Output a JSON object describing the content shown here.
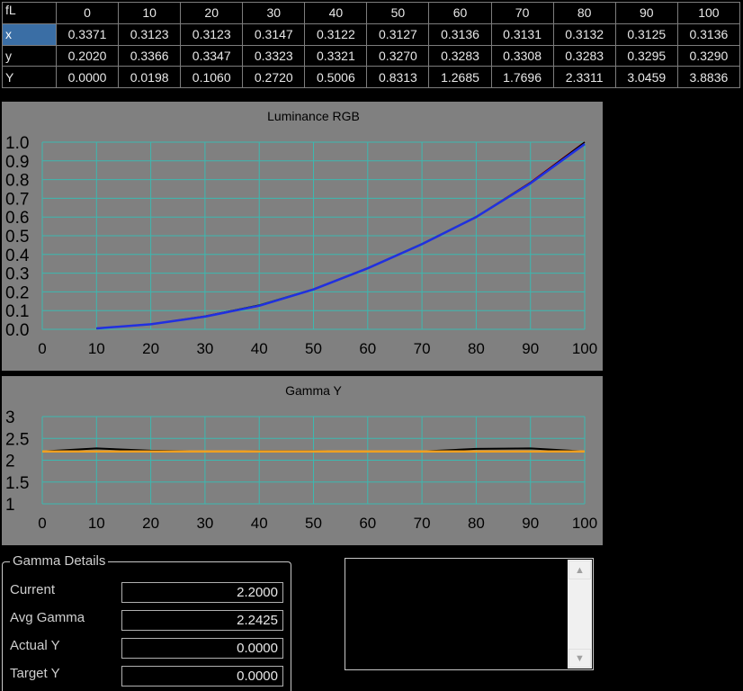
{
  "table": {
    "header_label": "fL",
    "columns": [
      "0",
      "10",
      "20",
      "30",
      "40",
      "50",
      "60",
      "70",
      "80",
      "90",
      "100"
    ],
    "rows": [
      {
        "label": "x",
        "values": [
          "0.3371",
          "0.3123",
          "0.3123",
          "0.3147",
          "0.3122",
          "0.3127",
          "0.3136",
          "0.3131",
          "0.3132",
          "0.3125",
          "0.3136"
        ]
      },
      {
        "label": "y",
        "values": [
          "0.2020",
          "0.3366",
          "0.3347",
          "0.3323",
          "0.3321",
          "0.3270",
          "0.3283",
          "0.3308",
          "0.3283",
          "0.3295",
          "0.3290"
        ]
      },
      {
        "label": "Y",
        "values": [
          "0.0000",
          "0.0198",
          "0.1060",
          "0.2720",
          "0.5006",
          "0.8313",
          "1.2685",
          "1.7696",
          "2.3311",
          "3.0459",
          "3.8836"
        ]
      }
    ]
  },
  "colors": {
    "panel_bg": "#808080",
    "grid": "#3cb8b0",
    "red_series": "#e0202a",
    "green_series": "#20a040",
    "blue_series": "#2030e0",
    "black_series": "#000000",
    "target_gamma": "#f0a020",
    "selection": "#3a6ea5"
  },
  "chart_data": [
    {
      "type": "line",
      "title": "Luminance RGB",
      "xlim": [
        0,
        100
      ],
      "ylim": [
        0,
        1.0
      ],
      "x_ticks": [
        "0",
        "10",
        "20",
        "30",
        "40",
        "50",
        "60",
        "70",
        "80",
        "90",
        "100"
      ],
      "y_ticks": [
        "0.0",
        "0.1",
        "0.2",
        "0.3",
        "0.4",
        "0.5",
        "0.6",
        "0.7",
        "0.8",
        "0.9",
        "1.0"
      ],
      "grid": true,
      "x": [
        10,
        20,
        30,
        40,
        50,
        60,
        70,
        80,
        90,
        100
      ],
      "series": [
        {
          "color": "#e0202a",
          "values": [
            0.005,
            0.027,
            0.07,
            0.128,
            0.214,
            0.327,
            0.456,
            0.601,
            0.785,
            1.0
          ]
        },
        {
          "color": "#20a040",
          "values": [
            0.005,
            0.027,
            0.07,
            0.13,
            0.215,
            0.327,
            0.458,
            0.603,
            0.784,
            0.99
          ]
        },
        {
          "color": "#000000",
          "values": [
            0.005,
            0.027,
            0.07,
            0.129,
            0.214,
            0.327,
            0.456,
            0.6,
            0.784,
            1.0
          ]
        },
        {
          "color": "#2030e0",
          "values": [
            0.005,
            0.027,
            0.068,
            0.126,
            0.213,
            0.326,
            0.455,
            0.6,
            0.78,
            0.99
          ]
        }
      ]
    },
    {
      "type": "line",
      "title": "Gamma Y",
      "xlim": [
        0,
        100
      ],
      "ylim": [
        1,
        3
      ],
      "x_ticks": [
        "0",
        "10",
        "20",
        "30",
        "40",
        "50",
        "60",
        "70",
        "80",
        "90",
        "100"
      ],
      "y_ticks": [
        "1",
        "1.5",
        "2",
        "2.5",
        "3"
      ],
      "grid": true,
      "x": [
        0,
        10,
        20,
        30,
        40,
        50,
        60,
        70,
        80,
        90,
        100
      ],
      "series": [
        {
          "color": "#000000",
          "values": [
            2.2,
            2.27,
            2.22,
            2.2,
            2.21,
            2.21,
            2.2,
            2.2,
            2.26,
            2.27,
            2.2
          ]
        },
        {
          "color": "#f0a020",
          "values": [
            2.2,
            2.2,
            2.2,
            2.2,
            2.2,
            2.2,
            2.2,
            2.2,
            2.2,
            2.2,
            2.2
          ]
        }
      ]
    }
  ],
  "gamma_details": {
    "legend": "Gamma Details",
    "current_label": "Current",
    "current_value": "2.2000",
    "avg_label": "Avg Gamma",
    "avg_value": "2.2425",
    "actual_label": "Actual Y",
    "actual_value": "0.0000",
    "target_label": "Target Y",
    "target_value": "0.0000"
  },
  "log": {
    "up_glyph": "▲",
    "down_glyph": "▼"
  }
}
